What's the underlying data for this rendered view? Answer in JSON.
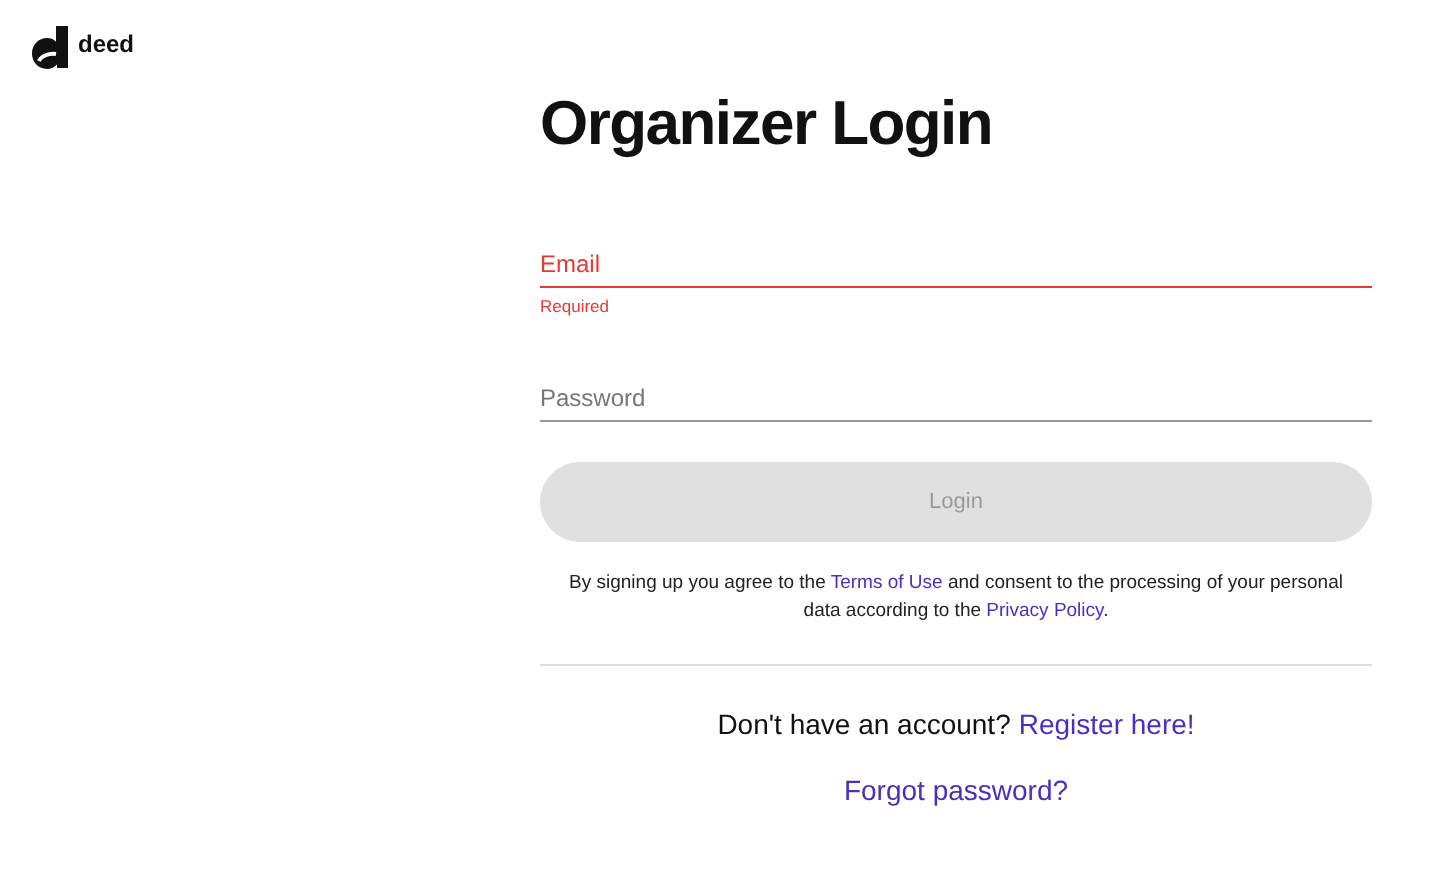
{
  "logo": {
    "text": "deed"
  },
  "title": "Organizer Login",
  "fields": [
    {
      "placeholder": "Email",
      "invalid": true,
      "error": "Required"
    },
    {
      "placeholder": "Password",
      "invalid": false
    }
  ],
  "login_button": {
    "label": "Login",
    "disabled": true
  },
  "consent": {
    "before": "By signing up you agree to the",
    "terms_link": "Terms of Use",
    "middle": "and consent to the processing of your personal data according to the",
    "privacy_link": "Privacy Policy",
    "after": "."
  },
  "register": {
    "prompt": "Don't have an account?",
    "link": "Register here!"
  },
  "forgot_link": "Forgot password?"
}
